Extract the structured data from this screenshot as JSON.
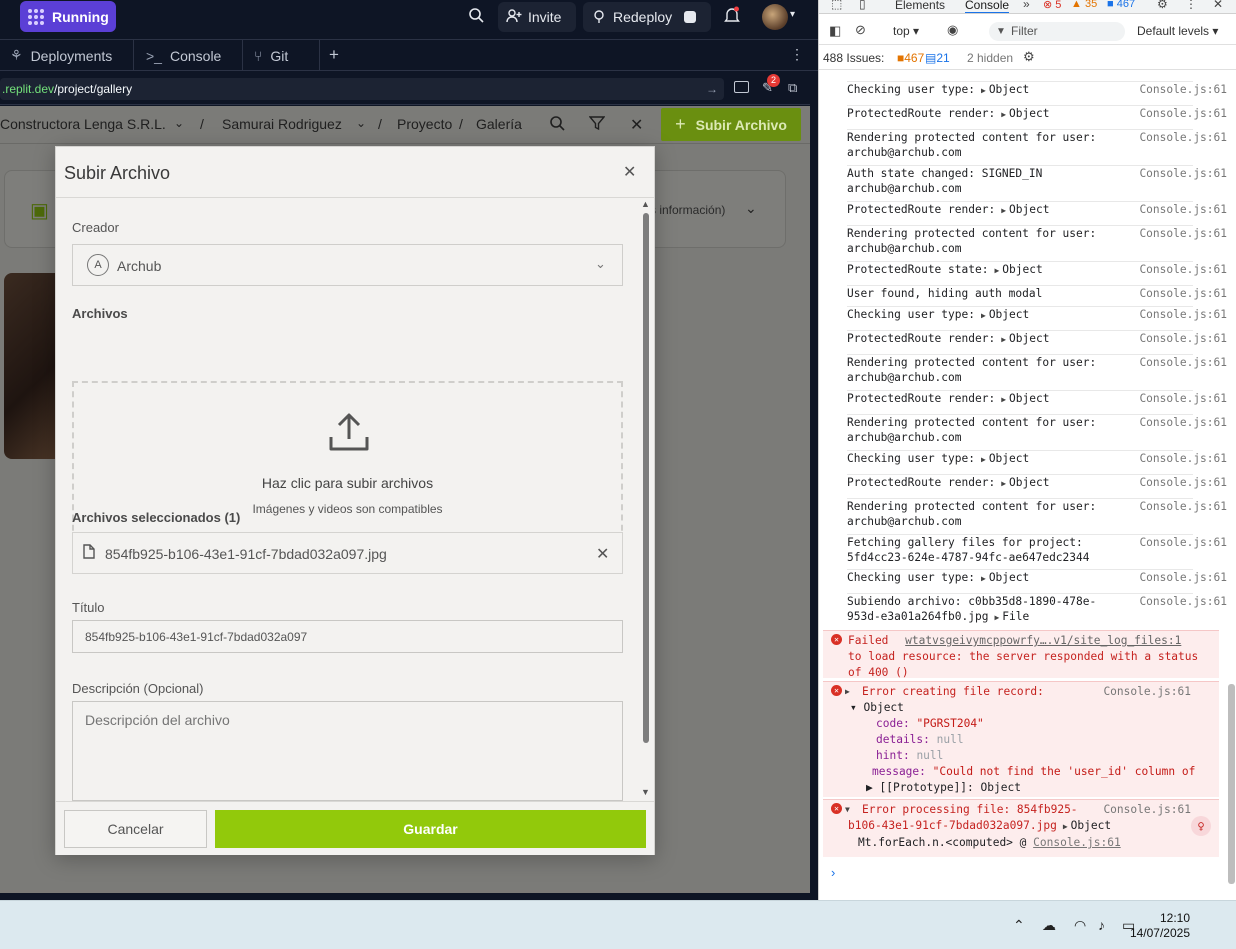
{
  "topbar": {
    "run_label": "Running",
    "invite_label": "Invite",
    "redeploy_label": "Redeploy"
  },
  "tabs": [
    {
      "label": "Deployments"
    },
    {
      "label": "Console"
    },
    {
      "label": "Git"
    }
  ],
  "url": {
    "domain_part": ".replit.dev",
    "path_part": "/project/gallery",
    "badge": "2"
  },
  "app": {
    "breadcrumb": [
      "Constructora Lenga S.R.L.",
      "Samurai Rodriguez",
      "Proyecto",
      "Galería"
    ],
    "sep": "/",
    "upload_button": "Subir Archivo",
    "info_text": "s información)"
  },
  "modal": {
    "title": "Subir Archivo",
    "creator_label": "Creador",
    "creator_initial": "A",
    "creator_value": "Archub",
    "files_label": "Archivos",
    "drop_title": "Haz clic para subir archivos",
    "drop_subtitle": "Imágenes y videos son compatibles",
    "selected_label": "Archivos seleccionados (1)",
    "selected_file": "854fb925-b106-43e1-91cf-7bdad032a097.jpg",
    "title_label": "Título",
    "title_value": "854fb925-b106-43e1-91cf-7bdad032a097",
    "desc_label": "Descripción (Opcional)",
    "desc_placeholder": "Descripción del archivo",
    "cancel_label": "Cancelar",
    "save_label": "Guardar"
  },
  "devtools": {
    "tabs": [
      "Elements",
      "Console"
    ],
    "errors": "5",
    "warnings": "35",
    "infos": "467",
    "context": "top",
    "filter_placeholder": "Filter",
    "levels": "Default levels",
    "issues_label": "488 Issues:",
    "issues_warn": "467",
    "issues_info": "21",
    "hidden": "2 hidden",
    "lines": [
      {
        "text": "Checking user type:",
        "obj": "Object",
        "src": "Console.js:61"
      },
      {
        "text": "ProtectedRoute render:",
        "obj": "Object",
        "src": "Console.js:61"
      },
      {
        "text": "Rendering protected content for user:",
        "text2": "archub@archub.com",
        "src": "Console.js:61"
      },
      {
        "text": "Auth state changed: SIGNED_IN",
        "text2": "archub@archub.com",
        "src": "Console.js:61"
      },
      {
        "text": "ProtectedRoute render:",
        "obj": "Object",
        "src": "Console.js:61"
      },
      {
        "text": "Rendering protected content for user:",
        "text2": "archub@archub.com",
        "src": "Console.js:61"
      },
      {
        "text": "ProtectedRoute state:",
        "obj": "Object",
        "src": "Console.js:61"
      },
      {
        "text": "User found, hiding auth modal",
        "src": "Console.js:61"
      },
      {
        "text": "Checking user type:",
        "obj": "Object",
        "src": "Console.js:61"
      },
      {
        "text": "ProtectedRoute render:",
        "obj": "Object",
        "src": "Console.js:61"
      },
      {
        "text": "Rendering protected content for user:",
        "text2": "archub@archub.com",
        "src": "Console.js:61"
      },
      {
        "text": "ProtectedRoute render:",
        "obj": "Object",
        "src": "Console.js:61"
      },
      {
        "text": "Rendering protected content for user:",
        "text2": "archub@archub.com",
        "src": "Console.js:61"
      },
      {
        "text": "Checking user type:",
        "obj": "Object",
        "src": "Console.js:61"
      },
      {
        "text": "ProtectedRoute render:",
        "obj": "Object",
        "src": "Console.js:61"
      },
      {
        "text": "Rendering protected content for user:",
        "text2": "archub@archub.com",
        "src": "Console.js:61"
      },
      {
        "text": "Fetching gallery files for project:",
        "text2": "5fd4cc23-624e-4787-94fc-ae647edc2344",
        "src": "Console.js:61"
      },
      {
        "text": "Checking user type:",
        "obj": "Object",
        "src": "Console.js:61"
      },
      {
        "text": "Subiendo archivo: c0bb35d8-1890-478e-",
        "text2": "953d-e3a01a264fb0.jpg",
        "obj2": "File",
        "src": "Console.js:61"
      }
    ],
    "err1": {
      "line1_a": "Failed",
      "link": "wtatvsgeivymcppowrfy….v1/site_log_files:1",
      "line2": "to load resource: the server responded with a status",
      "line3": "of 400 ()"
    },
    "err2": {
      "head": "Error creating file record:",
      "src": "Console.js:61",
      "obj": "Object",
      "code_k": "code:",
      "code_v": "\"PGRST204\"",
      "details_k": "details:",
      "details_v": "null",
      "hint_k": "hint:",
      "hint_v": "null",
      "msg_k": "message:",
      "msg_v": "\"Could not find the 'user_id' column of",
      "proto": "[[Prototype]]: Object"
    },
    "err3": {
      "head": "Error processing file: 854fb925-",
      "head2": "b106-43e1-91cf-7bdad032a097.jpg",
      "obj": "Object",
      "src": "Console.js:61",
      "stack": "Mt.forEach.n.<computed> @",
      "stack_src": "Console.js:61"
    }
  },
  "taskbar": {
    "time": "12:10",
    "date": "14/07/2025"
  }
}
